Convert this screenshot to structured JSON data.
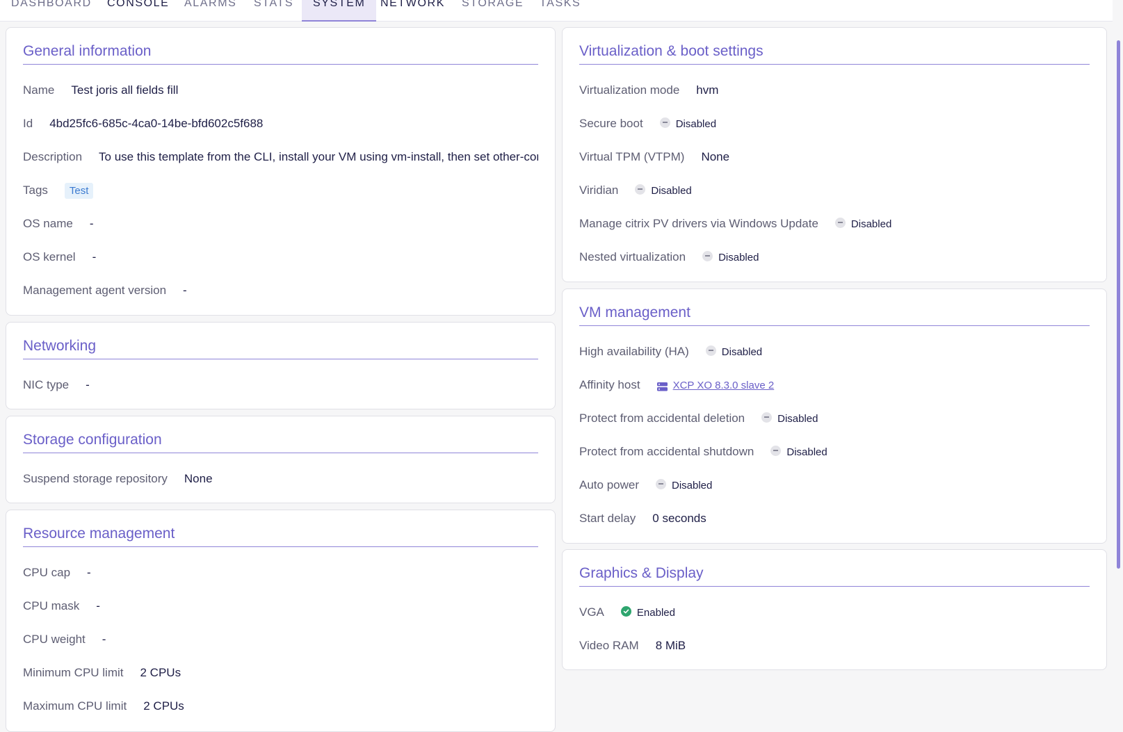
{
  "tabs": [
    "DASHBOARD",
    "CONSOLE",
    "ALARMS",
    "STATS",
    "SYSTEM",
    "NETWORK",
    "STORAGE",
    "TASKS"
  ],
  "general": {
    "title": "General information",
    "name_label": "Name",
    "name_value": "Test joris all fields fill",
    "id_label": "Id",
    "id_value": "4bd25fc6-685c-4ca0-14be-bfd602c5f688",
    "description_label": "Description",
    "description_value": "To use this template from the CLI, install your VM using vm-install, then set other-config:install-repository to the path to your network repository, e.g. http:// or nfs:server:/path",
    "tags_label": "Tags",
    "tag_value": "Test",
    "os_name_label": "OS name",
    "os_name_value": "-",
    "os_kernel_label": "OS kernel",
    "os_kernel_value": "-",
    "agent_label": "Management agent version",
    "agent_value": "-"
  },
  "networking": {
    "title": "Networking",
    "nic_label": "NIC type",
    "nic_value": "-"
  },
  "storage": {
    "title": "Storage configuration",
    "suspend_label": "Suspend storage repository",
    "suspend_value": "None"
  },
  "resource": {
    "title": "Resource management",
    "cpu_cap_label": "CPU cap",
    "cpu_cap_value": "-",
    "cpu_mask_label": "CPU mask",
    "cpu_mask_value": "-",
    "cpu_weight_label": "CPU weight",
    "cpu_weight_value": "-",
    "min_cpu_label": "Minimum CPU limit",
    "min_cpu_value": "2 CPUs",
    "max_cpu_label": "Maximum CPU limit",
    "max_cpu_value": "2 CPUs"
  },
  "virtualization": {
    "title": "Virtualization & boot settings",
    "mode_label": "Virtualization mode",
    "mode_value": "hvm",
    "secure_boot_label": "Secure boot",
    "secure_boot_value": "Disabled",
    "vtpm_label": "Virtual TPM (VTPM)",
    "vtpm_value": "None",
    "viridian_label": "Viridian",
    "viridian_value": "Disabled",
    "citrix_label": "Manage citrix PV drivers via Windows Update",
    "citrix_value": "Disabled",
    "nested_label": "Nested virtualization",
    "nested_value": "Disabled"
  },
  "vm_management": {
    "title": "VM management",
    "ha_label": "High availability (HA)",
    "ha_value": "Disabled",
    "affinity_label": "Affinity host",
    "affinity_value": "XCP XO 8.3.0 slave 2",
    "deletion_label": "Protect from accidental deletion",
    "deletion_value": "Disabled",
    "shutdown_label": "Protect from accidental shutdown",
    "shutdown_value": "Disabled",
    "auto_power_label": "Auto power",
    "auto_power_value": "Disabled",
    "start_delay_label": "Start delay",
    "start_delay_value": "0 seconds"
  },
  "graphics": {
    "title": "Graphics & Display",
    "vga_label": "VGA",
    "vga_value": "Enabled",
    "vram_label": "Video RAM",
    "vram_value": "8 MiB"
  },
  "colors": {
    "accent": "#6a5fc8",
    "enabled": "#2ea56e",
    "disabled": "#e3e3e8",
    "tag_bg": "#e6f1fb"
  },
  "icons": [
    "minus-circle-icon",
    "check-circle-icon",
    "server-icon"
  ]
}
